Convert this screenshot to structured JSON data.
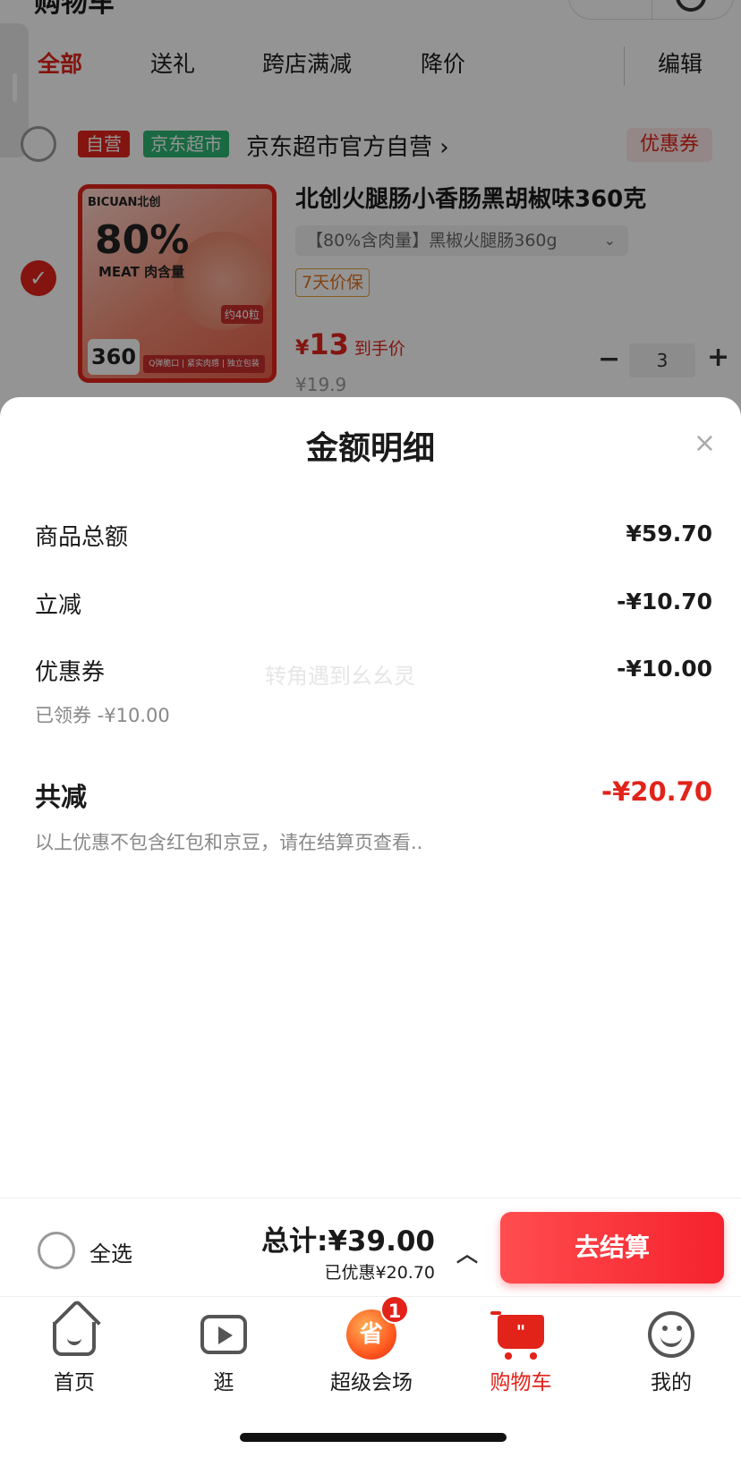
{
  "background_page": {
    "top_partial_title": "购物车",
    "tabs": [
      "全部",
      "送礼",
      "跨店满减",
      "降价"
    ],
    "edit_label": "编辑",
    "shop": {
      "badge_self": "自营",
      "badge_jd": "京东超市",
      "name": "京东超市官方自营 ›",
      "coupon_label": "优惠券"
    },
    "product": {
      "title": "北创火腿肠小香肠黑胡椒味360克",
      "spec": "【80%含肉量】黑椒火腿肠360g",
      "spec_chevron": "⌄",
      "guarantee_badge": "7天价保",
      "price_currency": "¥",
      "price": "13",
      "price_label": "到手价",
      "original_price": "¥19.9",
      "quantity": "3",
      "minus": "−",
      "plus": "+",
      "image": {
        "brand": "BICUAN北创",
        "pct": "80%",
        "meat": "MEAT 肉含量",
        "tag": "约40粒",
        "weight": "360",
        "bar": "Q弹脆口 | 紧实肉感 | 独立包装"
      }
    }
  },
  "sheet": {
    "title": "金额明细",
    "close_icon": "×",
    "rows": [
      {
        "label": "商品总额",
        "value": "¥59.70"
      },
      {
        "label": "立减",
        "value": "-¥10.70"
      },
      {
        "label": "优惠券",
        "value": "-¥10.00"
      }
    ],
    "coupon_sub": "已领券 -¥10.00",
    "watermark": "转角遇到幺幺灵",
    "total_label": "共减",
    "total_value": "-¥20.70",
    "note": "以上优惠不包含红包和京豆，请在结算页查看.."
  },
  "checkout": {
    "select_all": "全选",
    "total": "总计:¥39.00",
    "saved": "已优惠¥20.70",
    "chevron": "︿",
    "button": "去结算"
  },
  "tabbar": {
    "items": [
      {
        "label": "首页",
        "icon": "home-icon"
      },
      {
        "label": "逛",
        "icon": "video-icon"
      },
      {
        "label": "超级会场",
        "icon": "super-venue-icon",
        "badge": "1"
      },
      {
        "label": "购物车",
        "icon": "cart-icon",
        "active": true
      },
      {
        "label": "我的",
        "icon": "smiley-icon"
      }
    ],
    "super_glyph": "省",
    "cart_glyph": "\""
  },
  "colors": {
    "accent": "#e2231a",
    "jd_green": "#2bb673",
    "muted": "#888888"
  }
}
